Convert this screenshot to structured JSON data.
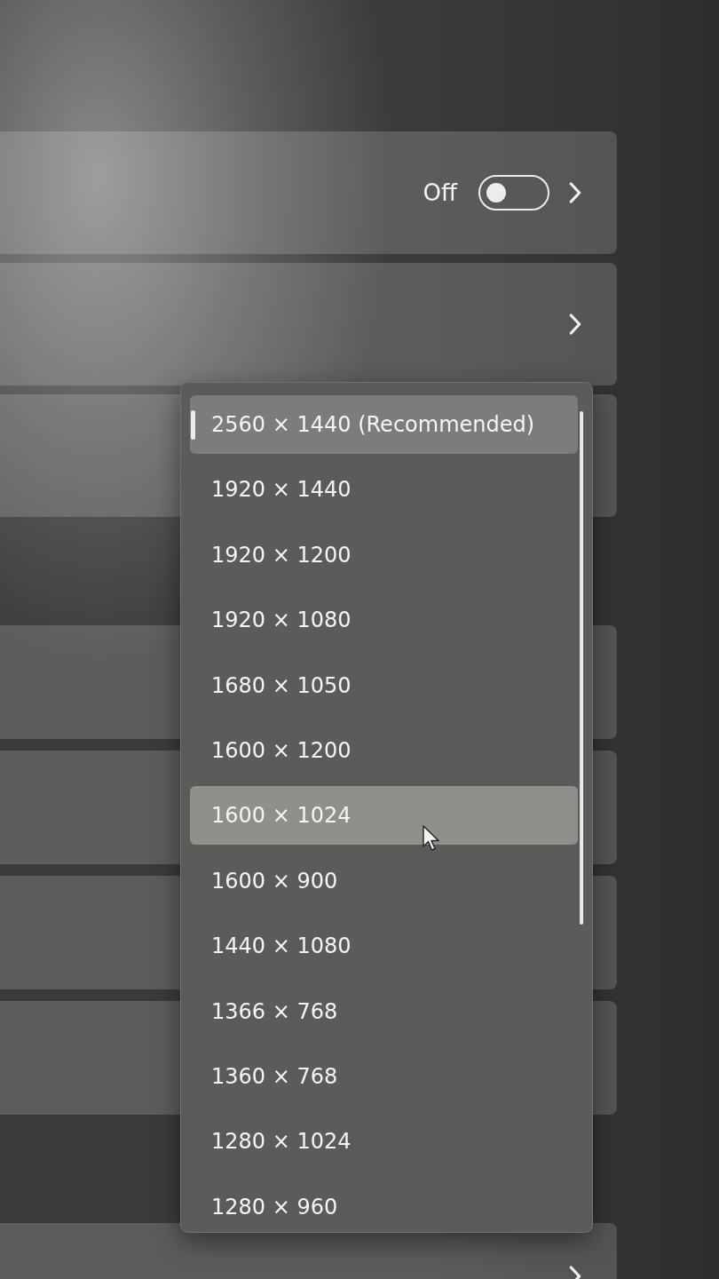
{
  "settings": {
    "sections": [
      {
        "rows": [
          {
            "kind": "toggle",
            "state_label": "Off",
            "on": false
          },
          {
            "kind": "link"
          },
          {
            "kind": "blank"
          }
        ]
      },
      {
        "rows": [
          {
            "kind": "blank"
          },
          {
            "kind": "blank"
          },
          {
            "kind": "blank"
          },
          {
            "kind": "blank"
          }
        ]
      },
      {
        "rows": [
          {
            "kind": "link"
          }
        ]
      }
    ]
  },
  "resolution_menu": {
    "options": [
      {
        "label": "2560 × 1440 (Recommended)",
        "selected": true,
        "hovered": false
      },
      {
        "label": "1920 × 1440",
        "selected": false,
        "hovered": false
      },
      {
        "label": "1920 × 1200",
        "selected": false,
        "hovered": false
      },
      {
        "label": "1920 × 1080",
        "selected": false,
        "hovered": false
      },
      {
        "label": "1680 × 1050",
        "selected": false,
        "hovered": false
      },
      {
        "label": "1600 × 1200",
        "selected": false,
        "hovered": false
      },
      {
        "label": "1600 × 1024",
        "selected": false,
        "hovered": true
      },
      {
        "label": "1600 × 900",
        "selected": false,
        "hovered": false
      },
      {
        "label": "1440 × 1080",
        "selected": false,
        "hovered": false
      },
      {
        "label": "1366 × 768",
        "selected": false,
        "hovered": false
      },
      {
        "label": "1360 × 768",
        "selected": false,
        "hovered": false
      },
      {
        "label": "1280 × 1024",
        "selected": false,
        "hovered": false
      },
      {
        "label": "1280 × 960",
        "selected": false,
        "hovered": false
      }
    ]
  }
}
